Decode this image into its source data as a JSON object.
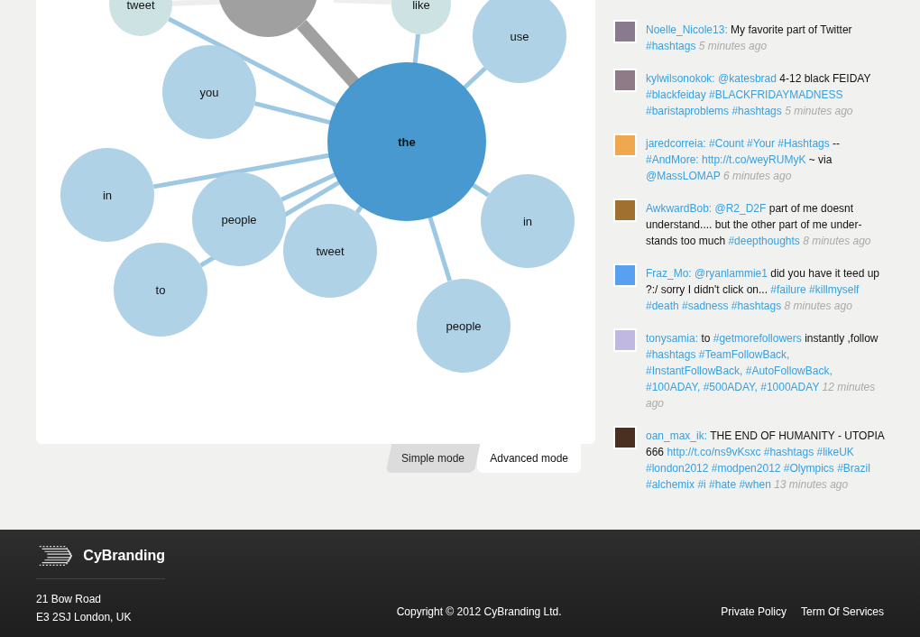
{
  "graph": {
    "nodes": [
      {
        "kind": "faded",
        "label": "tweet"
      },
      {
        "kind": "grey"
      },
      {
        "kind": "faded",
        "label": "like"
      },
      {
        "kind": "word",
        "label": "use"
      },
      {
        "kind": "word",
        "label": "you"
      },
      {
        "kind": "hub",
        "label": "the"
      },
      {
        "kind": "word",
        "label": "in"
      },
      {
        "kind": "word",
        "label": "people"
      },
      {
        "kind": "word",
        "label": "tweet"
      },
      {
        "kind": "word",
        "label": "in"
      },
      {
        "kind": "word",
        "label": "to"
      },
      {
        "kind": "word",
        "label": "people"
      }
    ]
  },
  "mode_tabs": [
    {
      "label": "Simple mode",
      "selected": false
    },
    {
      "label": "Advanced mode",
      "selected": true
    }
  ],
  "tweets": [
    {
      "segments": [
        {
          "kind": "user",
          "text": "Noelle_Nicole13:"
        },
        {
          "kind": "text",
          "text": "My favorite part of Twitter"
        },
        {
          "kind": "tag",
          "text": "#hashtags"
        },
        {
          "kind": "time",
          "text": "5 minutes ago"
        }
      ]
    },
    {
      "segments": [
        {
          "kind": "user",
          "text": "kylwilsonokok:"
        },
        {
          "kind": "tag",
          "text": "@katesbrad"
        },
        {
          "kind": "text",
          "text": "4-12 black FEIDAY"
        },
        {
          "kind": "tag",
          "text": "#blackfeiday"
        },
        {
          "kind": "tag",
          "text": "#BLACKFRIDAYMADNESS"
        },
        {
          "kind": "tag",
          "text": "#baristaproblems"
        },
        {
          "kind": "tag",
          "text": "#hashtags"
        },
        {
          "kind": "time",
          "text": "5 minutes ago"
        }
      ]
    },
    {
      "segments": [
        {
          "kind": "user",
          "text": "jaredcorreia:"
        },
        {
          "kind": "tag",
          "text": "#Count"
        },
        {
          "kind": "tag",
          "text": "#Your"
        },
        {
          "kind": "tag",
          "text": "#Hashtags"
        },
        {
          "kind": "text",
          "text": "--"
        },
        {
          "kind": "tag",
          "text": "#AndMore:"
        },
        {
          "kind": "tag",
          "text": "http://t.co/weyRUMyK"
        },
        {
          "kind": "text",
          "text": "~ via"
        },
        {
          "kind": "tag",
          "text": "@MassLOMAP"
        },
        {
          "kind": "time",
          "text": "6 minutes ago"
        }
      ]
    },
    {
      "segments": [
        {
          "kind": "user",
          "text": "AwkwardBob:"
        },
        {
          "kind": "tag",
          "text": "@R2_D2F"
        },
        {
          "kind": "text",
          "text": "part of me doesnt understand.... but the other part of me under-stands too much"
        },
        {
          "kind": "tag",
          "text": "#deepthoughts"
        },
        {
          "kind": "time",
          "text": "8 minutes ago"
        }
      ]
    },
    {
      "segments": [
        {
          "kind": "user",
          "text": "Fraz_Mo:"
        },
        {
          "kind": "tag",
          "text": "@ryanlammie1"
        },
        {
          "kind": "text",
          "text": "did you have it teed up ?:/ sorry I didn't click on..."
        },
        {
          "kind": "tag",
          "text": "#failure"
        },
        {
          "kind": "tag",
          "text": "#killmyself"
        },
        {
          "kind": "tag",
          "text": "#death"
        },
        {
          "kind": "tag",
          "text": "#sadness"
        },
        {
          "kind": "tag",
          "text": "#hashtags"
        },
        {
          "kind": "time",
          "text": "8 minutes ago"
        }
      ]
    },
    {
      "segments": [
        {
          "kind": "user",
          "text": "tonysamia:"
        },
        {
          "kind": "text",
          "text": "to"
        },
        {
          "kind": "tag",
          "text": "#getmorefollowers"
        },
        {
          "kind": "text",
          "text": "instantly ,follow"
        },
        {
          "kind": "tag",
          "text": "#hashtags"
        },
        {
          "kind": "tag",
          "text": "#TeamFollowBack,"
        },
        {
          "kind": "tag",
          "text": "#InstantFollowBack,"
        },
        {
          "kind": "tag",
          "text": "#AutoFollowBack,"
        },
        {
          "kind": "tag",
          "text": "#100ADAY,"
        },
        {
          "kind": "tag",
          "text": "#500ADAY,"
        },
        {
          "kind": "tag",
          "text": "#1000ADAY"
        },
        {
          "kind": "time",
          "text": "12 minutes ago"
        }
      ]
    },
    {
      "segments": [
        {
          "kind": "user",
          "text": "oan_max_ik:"
        },
        {
          "kind": "text",
          "text": "THE END OF HUMANITY - UTOPIA 666"
        },
        {
          "kind": "tag",
          "text": "http://t.co/ns9vKsxc"
        },
        {
          "kind": "tag",
          "text": "#hashtags"
        },
        {
          "kind": "tag",
          "text": "#likeUK"
        },
        {
          "kind": "tag",
          "text": "#london2012"
        },
        {
          "kind": "tag",
          "text": "#modpen2012"
        },
        {
          "kind": "tag",
          "text": "#Olympics"
        },
        {
          "kind": "tag",
          "text": "#Brazil"
        },
        {
          "kind": "tag",
          "text": "#alchemix"
        },
        {
          "kind": "tag",
          "text": "#i"
        },
        {
          "kind": "tag",
          "text": "#hate"
        },
        {
          "kind": "tag",
          "text": "#when"
        },
        {
          "kind": "time",
          "text": "13 minutes ago"
        }
      ]
    }
  ],
  "footer": {
    "brand": "CyBranding",
    "address": [
      "21 Bow Road",
      "E3 2SJ London, UK"
    ],
    "copyright": "Copyright © 2012 CyBranding Ltd.",
    "links": [
      "Private Policy",
      "Term Of Services"
    ]
  }
}
